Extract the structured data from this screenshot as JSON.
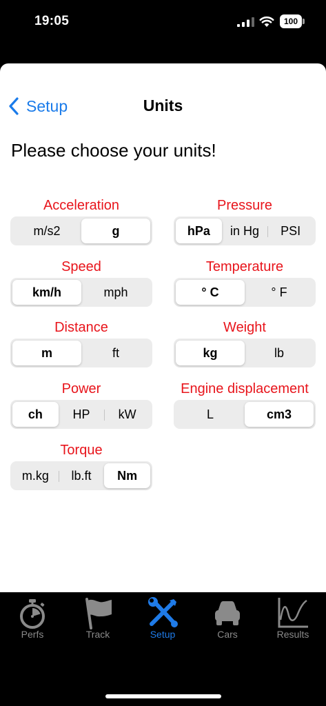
{
  "status": {
    "time": "19:05",
    "battery": "100"
  },
  "nav": {
    "back_label": "Setup",
    "title": "Units"
  },
  "prompt": "Please choose your units!",
  "units": {
    "acceleration": {
      "label": "Acceleration",
      "options": [
        "m/s2",
        "g"
      ],
      "selected": "g"
    },
    "pressure": {
      "label": "Pressure",
      "options": [
        "hPa",
        "in Hg",
        "PSI"
      ],
      "selected": "hPa"
    },
    "speed": {
      "label": "Speed",
      "options": [
        "km/h",
        "mph"
      ],
      "selected": "km/h"
    },
    "temperature": {
      "label": "Temperature",
      "options": [
        "° C",
        "° F"
      ],
      "selected": "° C"
    },
    "distance": {
      "label": "Distance",
      "options": [
        "m",
        "ft"
      ],
      "selected": "m"
    },
    "weight": {
      "label": "Weight",
      "options": [
        "kg",
        "lb"
      ],
      "selected": "kg"
    },
    "power": {
      "label": "Power",
      "options": [
        "ch",
        "HP",
        "kW"
      ],
      "selected": "ch"
    },
    "engine_displacement": {
      "label": "Engine displacement",
      "options": [
        "L",
        "cm3"
      ],
      "selected": "cm3"
    },
    "torque": {
      "label": "Torque",
      "options": [
        "m.kg",
        "lb.ft",
        "Nm"
      ],
      "selected": "Nm"
    }
  },
  "tabs": [
    {
      "label": "Perfs",
      "icon": "stopwatch-icon"
    },
    {
      "label": "Track",
      "icon": "flag-icon"
    },
    {
      "label": "Setup",
      "icon": "tools-icon",
      "active": true
    },
    {
      "label": "Cars",
      "icon": "car-icon"
    },
    {
      "label": "Results",
      "icon": "chart-icon"
    }
  ],
  "colors": {
    "accent_blue": "#1a7bea",
    "label_red": "#e8141b",
    "segment_bg": "#ececec"
  }
}
